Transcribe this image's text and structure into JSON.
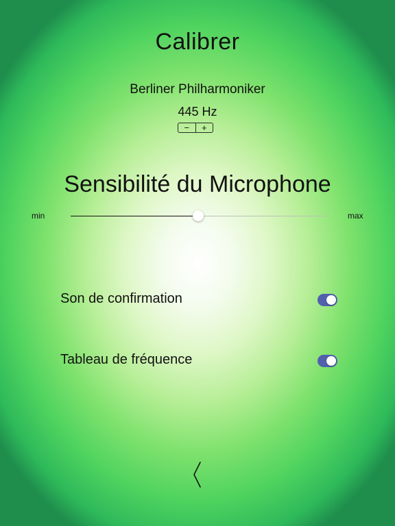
{
  "header": {
    "title": "Calibrer"
  },
  "tuning": {
    "orchestra": "Berliner Philharmoniker",
    "frequency": "445 Hz",
    "decrement_label": "−",
    "increment_label": "+"
  },
  "microphone": {
    "title": "Sensibilité du Microphone",
    "min_label": "min",
    "max_label": "max",
    "sensitivity_fraction": 0.5
  },
  "settings": {
    "items": [
      {
        "label": "Son de confirmation",
        "enabled": true
      },
      {
        "label": "Tableau de fréquence",
        "enabled": true
      }
    ]
  },
  "navigation": {
    "back_icon": "chevron-left-icon"
  },
  "colors": {
    "toggle_on": "#5060ad",
    "background_center": "#ffffff",
    "background_edge": "#1f8e4d"
  }
}
